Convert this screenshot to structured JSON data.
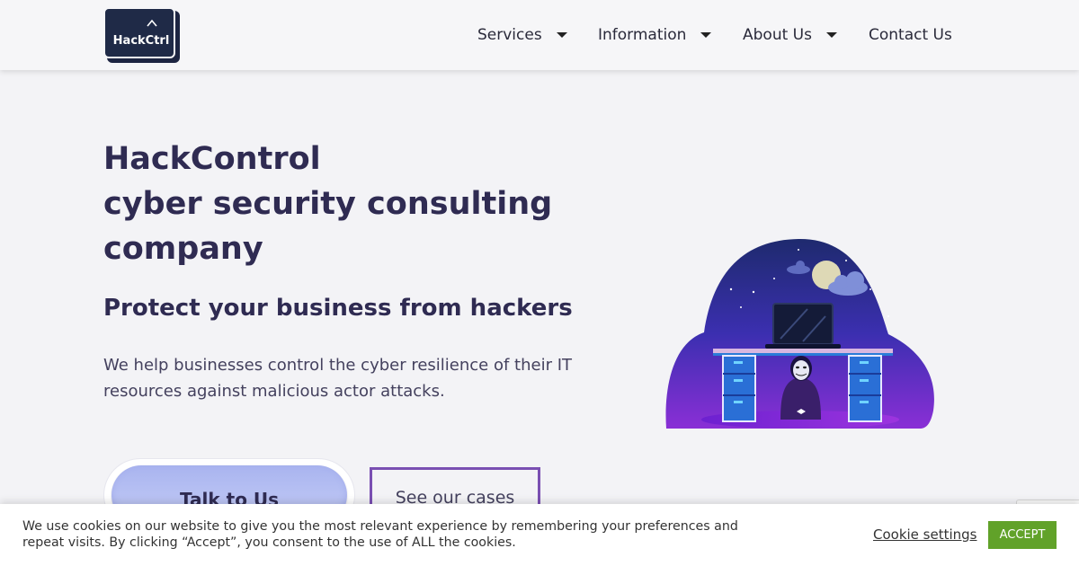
{
  "header": {
    "logo_text": "HackCtrl",
    "nav": [
      {
        "label": "Services",
        "has_dropdown": true
      },
      {
        "label": "Information",
        "has_dropdown": true
      },
      {
        "label": "About Us",
        "has_dropdown": true
      },
      {
        "label": "Contact Us",
        "has_dropdown": false
      }
    ]
  },
  "hero": {
    "title_lines": [
      "HackControl",
      "cyber security consulting",
      "company"
    ],
    "subtitle": "Protect your business from hackers",
    "description": "We help businesses control the cyber resilience of their IT resources against malicious actor attacks.",
    "primary_button": "Talk to Us",
    "secondary_button": "See our cases"
  },
  "cookie_banner": {
    "text": "We use cookies on our website to give you the most relevant experience by remembering your preferences and repeat visits. By clicking “Accept”, you consent to the use of ALL the cookies.",
    "settings_label": "Cookie settings",
    "accept_label": "ACCEPT"
  },
  "colors": {
    "page_bg": "#f3f3f6",
    "heading": "#2f2b52",
    "accept_green": "#61a229",
    "outline_purple": "#7a4fb2",
    "logo_navy": "#1f2a47"
  },
  "icons": {
    "nav_dropdown": "caret-down-icon",
    "logo_mark": "chevron-up-icon"
  }
}
